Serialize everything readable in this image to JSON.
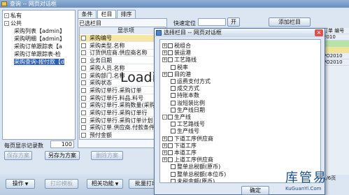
{
  "main": {
    "title": "查询 -- 网页对话框",
    "tree": [
      {
        "label": "私有",
        "indent": 0,
        "expander": "-"
      },
      {
        "label": "公共",
        "indent": 0,
        "expander": "-"
      },
      {
        "label": "采购列表【admin】",
        "indent": 1,
        "expander": ""
      },
      {
        "label": "采购明细【admin】",
        "indent": 1,
        "expander": ""
      },
      {
        "label": "采购订单跟踪表【a",
        "indent": 1,
        "expander": ""
      },
      {
        "label": "采购订单跟踪表-检",
        "indent": 1,
        "expander": ""
      },
      {
        "label": "采购查询-按付款【d",
        "indent": 1,
        "expander": "",
        "selected": true
      }
    ],
    "per_page_label": "每页显示记录数",
    "per_page_value": "100",
    "buttons": {
      "save_as_plan": "保存方案",
      "save_as_other": "另存为方案",
      "delete_plan": "删除方案"
    },
    "tabs": [
      "条件",
      "栏目",
      "排序"
    ],
    "active_tab": 1,
    "selected_cols_label": "已选栏目",
    "quick_locate_label": "快速定位",
    "find_button": "开",
    "add_column_button": "添加栏目",
    "grid_header": "显示项",
    "columns": [
      "采购编号",
      "采购类型.名称",
      "订货供应商.供应商名称",
      "业务日期",
      "采购人员.名称",
      "采购部门.名称",
      "采购状态",
      "采购订单行.采购订单",
      "采购订单行.料品.料号",
      "采购订单行.采购数量(采购单位)",
      "采购订单行.采购订单行",
      "采购订单行.采购订单计划",
      "采购订单.供应商.付款条件",
      "预付金额"
    ],
    "loading_text": "Loading...",
    "bottom_buttons": [
      "操作",
      "相关功能",
      "批量打印"
    ],
    "bottom_disabled_button": "打印模板",
    "strip_rows": [
      "订单 编号",
      "2010",
      "PO2010",
      "PO2010",
      "PO2010",
      "PO2010"
    ],
    "strip_pager": "1/6页"
  },
  "dialog": {
    "title": "选择栏目 -- 网页对话框",
    "close_label": "×",
    "items": [
      {
        "label": "税组合",
        "level": 0,
        "exp": "+",
        "chk": true
      },
      {
        "label": "装运港",
        "level": 0,
        "exp": "+",
        "chk": true
      },
      {
        "label": "工艺路线",
        "level": 0,
        "exp": "+",
        "chk": true
      },
      {
        "label": "税率",
        "level": 1,
        "exp": "",
        "chk": true
      },
      {
        "label": "目的港",
        "level": 0,
        "exp": "+",
        "chk": true
      },
      {
        "label": "运费支付方式",
        "level": 1,
        "exp": "",
        "chk": true
      },
      {
        "label": "成交方式",
        "level": 1,
        "exp": "",
        "chk": true
      },
      {
        "label": "持账本数",
        "level": 1,
        "exp": "",
        "chk": true
      },
      {
        "label": "溢短装比例",
        "level": 1,
        "exp": "",
        "chk": true
      },
      {
        "label": "生产线日期",
        "level": 1,
        "exp": "",
        "chk": true
      },
      {
        "label": "生产线",
        "level": 0,
        "exp": "-",
        "chk": true
      },
      {
        "label": "工艺路线号",
        "level": 1,
        "exp": "",
        "chk": true
      },
      {
        "label": "生产线号",
        "level": 1,
        "exp": "",
        "chk": true
      },
      {
        "label": "下道工序供应商",
        "level": 0,
        "exp": "+",
        "chk": true
      },
      {
        "label": "下道工序",
        "level": 0,
        "exp": "+",
        "chk": true
      },
      {
        "label": "本道工序",
        "level": 0,
        "exp": "+",
        "chk": true
      },
      {
        "label": "上道工序供应商",
        "level": 0,
        "exp": "+",
        "chk": true
      },
      {
        "label": "整单总税额(原币)",
        "level": 1,
        "exp": "",
        "chk": true
      },
      {
        "label": "整单总税额(本位币)",
        "level": 1,
        "exp": "",
        "chk": true
      },
      {
        "label": "未税金额(原币)",
        "level": 1,
        "exp": "",
        "chk": true
      }
    ],
    "ok_button": "确定"
  },
  "watermark": {
    "logo": "库管易",
    "url": "KuGuanYi.Com"
  }
}
